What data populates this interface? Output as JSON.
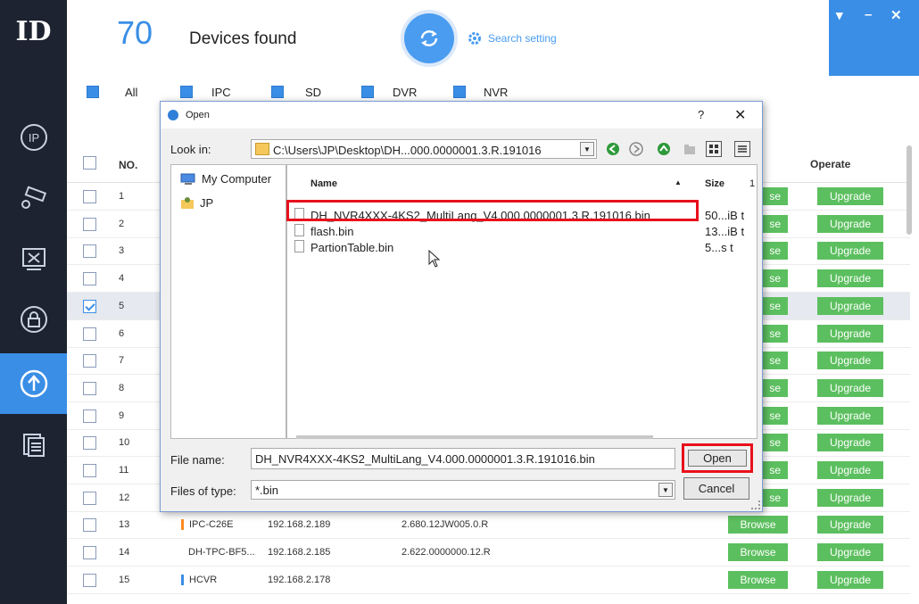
{
  "app": {
    "logo_text": "ID",
    "device_count": "70",
    "devices_found_label": "Devices found",
    "search_setting_label": "Search setting",
    "window_controls": {
      "menu": "▾",
      "minimize": "–",
      "close": "✕"
    }
  },
  "sidebar": {
    "items": [
      {
        "name": "ip-icon",
        "active": false
      },
      {
        "name": "camera-settings-icon",
        "active": false
      },
      {
        "name": "tools-icon",
        "active": false
      },
      {
        "name": "security-lock-icon",
        "active": false
      },
      {
        "name": "upgrade-icon",
        "active": true
      },
      {
        "name": "documents-icon",
        "active": false
      }
    ]
  },
  "filters": {
    "all": "All",
    "ipc": "IPC",
    "sd": "SD",
    "dvr": "DVR",
    "nvr": "NVR"
  },
  "table": {
    "headers": {
      "no": "NO.",
      "operate": "Operate"
    },
    "browse_label": "Browse",
    "upgrade_label": "Upgrade",
    "rows": [
      {
        "no": "1",
        "type": "",
        "ip": "",
        "version": "",
        "checked": false
      },
      {
        "no": "2",
        "type": "",
        "ip": "",
        "version": "",
        "checked": false
      },
      {
        "no": "3",
        "type": "",
        "ip": "",
        "version": "",
        "checked": false
      },
      {
        "no": "4",
        "type": "",
        "ip": "",
        "version": "",
        "checked": false
      },
      {
        "no": "5",
        "type": "",
        "ip": "",
        "version": "",
        "checked": true
      },
      {
        "no": "6",
        "type": "",
        "ip": "",
        "version": "",
        "checked": false
      },
      {
        "no": "7",
        "type": "",
        "ip": "",
        "version": "",
        "checked": false
      },
      {
        "no": "8",
        "type": "",
        "ip": "",
        "version": "",
        "checked": false
      },
      {
        "no": "9",
        "type": "",
        "ip": "",
        "version": "",
        "checked": false
      },
      {
        "no": "10",
        "type": "",
        "ip": "",
        "version": "",
        "checked": false
      },
      {
        "no": "11",
        "type": "",
        "ip": "",
        "version": "",
        "checked": false
      },
      {
        "no": "12",
        "type": "",
        "ip": "",
        "version": "",
        "checked": false
      },
      {
        "no": "13",
        "type": "IPC-C26E",
        "ip": "192.168.2.189",
        "version": "2.680.12JW005.0.R",
        "checked": false
      },
      {
        "no": "14",
        "type": "DH-TPC-BF5...",
        "ip": "192.168.2.185",
        "version": "2.622.0000000.12.R",
        "checked": false
      },
      {
        "no": "15",
        "type": "HCVR",
        "ip": "192.168.2.178",
        "version": "",
        "checked": false
      }
    ],
    "partial_browse_label": "se"
  },
  "dialog": {
    "title": "Open",
    "help": "?",
    "close": "✕",
    "look_in_label": "Look in:",
    "look_in_path": "C:\\Users\\JP\\Desktop\\DH...000.0000001.3.R.191016",
    "places": [
      "My Computer",
      "JP"
    ],
    "columns": {
      "name": "Name",
      "size": "Size",
      "sep": "1"
    },
    "files": [
      {
        "name": "DH_NVR4XXX-4KS2_MultiLang_V4.000.0000001.3.R.191016.bin",
        "size": "50...iB t"
      },
      {
        "name": "flash.bin",
        "size": "13...iB t"
      },
      {
        "name": "PartionTable.bin",
        "size": "5...s t"
      }
    ],
    "file_name_label": "File name:",
    "file_name_value": "DH_NVR4XXX-4KS2_MultiLang_V4.000.0000001.3.R.191016.bin",
    "file_type_label": "Files of type:",
    "file_type_value": "*.bin",
    "open_label": "Open",
    "cancel_label": "Cancel"
  }
}
